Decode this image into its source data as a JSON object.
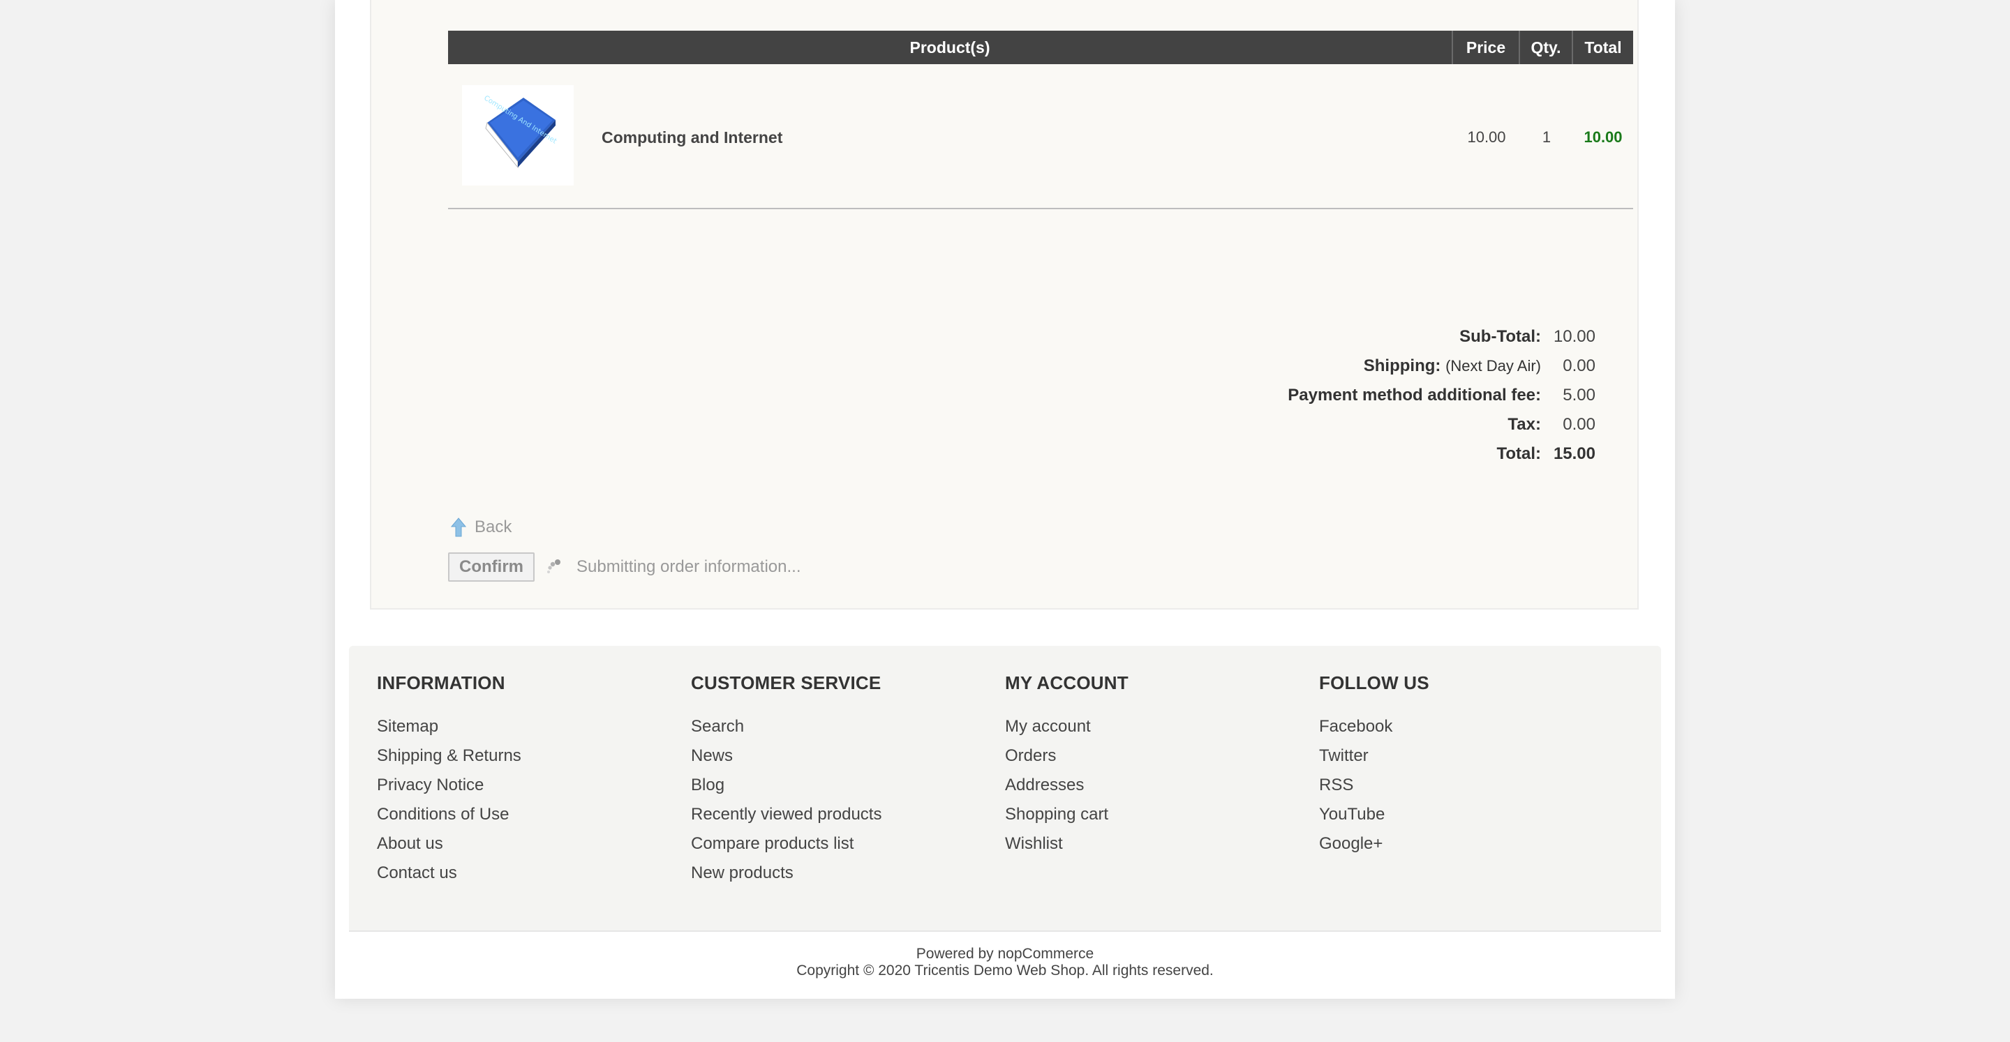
{
  "cart": {
    "headers": {
      "product": "Product(s)",
      "price": "Price",
      "qty": "Qty.",
      "total": "Total"
    },
    "items": [
      {
        "name": "Computing and Internet",
        "price": "10.00",
        "qty": "1",
        "total": "10.00",
        "cover_text": "Computing And Internet"
      }
    ]
  },
  "totals": {
    "subtotal_label": "Sub-Total:",
    "subtotal": "10.00",
    "shipping_label": "Shipping:",
    "shipping_method": "(Next Day Air)",
    "shipping": "0.00",
    "fee_label": "Payment method additional fee:",
    "fee": "5.00",
    "tax_label": "Tax:",
    "tax": "0.00",
    "total_label": "Total:",
    "total": "15.00"
  },
  "actions": {
    "back_label": "Back",
    "confirm_label": "Confirm",
    "submitting_text": "Submitting order information..."
  },
  "footer": {
    "columns": [
      {
        "title": "INFORMATION",
        "links": [
          "Sitemap",
          "Shipping & Returns",
          "Privacy Notice",
          "Conditions of Use",
          "About us",
          "Contact us"
        ]
      },
      {
        "title": "CUSTOMER SERVICE",
        "links": [
          "Search",
          "News",
          "Blog",
          "Recently viewed products",
          "Compare products list",
          "New products"
        ]
      },
      {
        "title": "MY ACCOUNT",
        "links": [
          "My account",
          "Orders",
          "Addresses",
          "Shopping cart",
          "Wishlist"
        ]
      },
      {
        "title": "FOLLOW US",
        "links": [
          "Facebook",
          "Twitter",
          "RSS",
          "YouTube",
          "Google+"
        ]
      }
    ],
    "powered_by": "Powered by nopCommerce",
    "copyright": "Copyright © 2020 Tricentis Demo Web Shop. All rights reserved."
  },
  "colors": {
    "table_header_bg": "#434343",
    "total_green": "#1a7a1a",
    "page_bg": "#f2f2f2"
  }
}
